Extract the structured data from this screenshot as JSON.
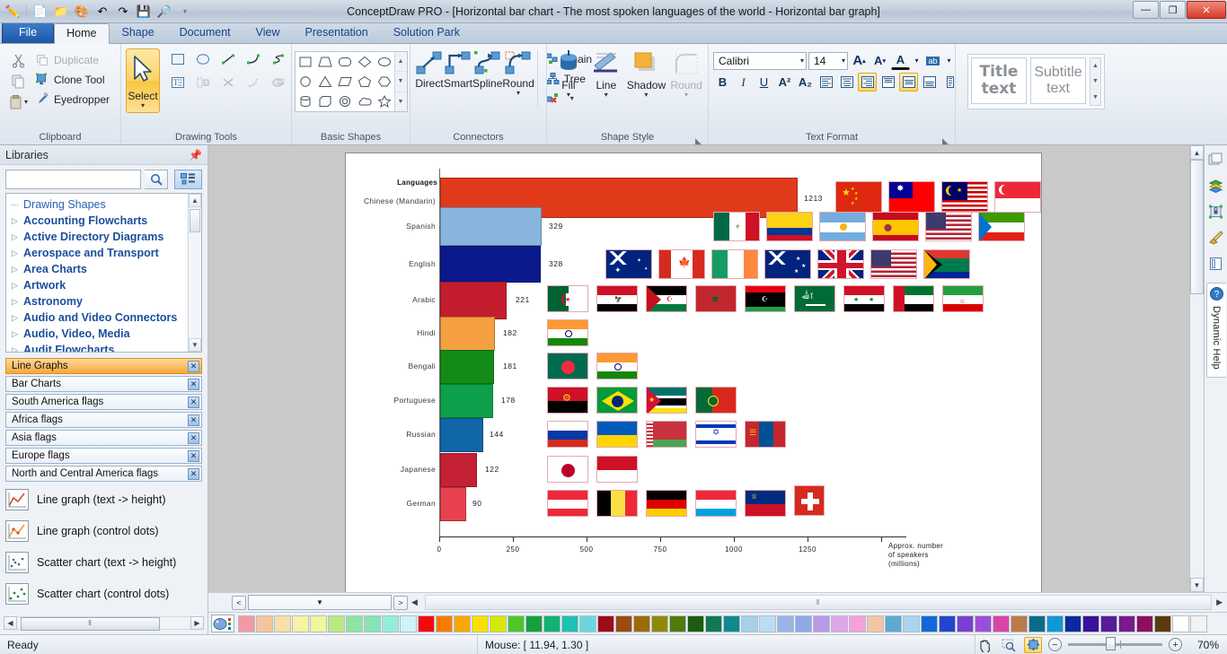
{
  "window": {
    "title": "ConceptDraw PRO - [Horizontal bar chart - The most spoken languages of the world - Horizontal bar graph]",
    "minimize": "—",
    "maximize": "❐",
    "close": "✕"
  },
  "quick_access": [
    {
      "name": "pen-icon",
      "glyph": "✏"
    },
    {
      "name": "new-document-icon",
      "glyph": "📄"
    },
    {
      "name": "open-folder-icon",
      "glyph": "📂"
    },
    {
      "name": "colors-icon",
      "glyph": "🎨"
    },
    {
      "name": "undo-icon",
      "glyph": "↶"
    },
    {
      "name": "redo-icon",
      "glyph": "↷"
    },
    {
      "name": "save-icon",
      "glyph": "💾"
    },
    {
      "name": "print-preview-icon",
      "glyph": "🔍"
    }
  ],
  "tabs": [
    {
      "label": "File",
      "active": false,
      "file": true
    },
    {
      "label": "Home",
      "active": true
    },
    {
      "label": "Shape",
      "active": false
    },
    {
      "label": "Document",
      "active": false
    },
    {
      "label": "View",
      "active": false
    },
    {
      "label": "Presentation",
      "active": false
    },
    {
      "label": "Solution Park",
      "active": false
    }
  ],
  "ribbon": {
    "clipboard": {
      "label": "Clipboard",
      "cut": "Cut",
      "copy": "Copy",
      "paste": "Paste",
      "duplicate": "Duplicate",
      "clone_tool": "Clone Tool",
      "eyedropper": "Eyedropper"
    },
    "drawing_tools": {
      "label": "Drawing Tools",
      "select": "Select"
    },
    "basic_shapes": {
      "label": "Basic Shapes"
    },
    "connectors": {
      "label": "Connectors",
      "direct": "Direct",
      "smart": "Smart",
      "spline": "Spline",
      "round": "Round",
      "chain": "Chain",
      "tree": "Tree"
    },
    "shape_style": {
      "label": "Shape Style",
      "fill": "Fill",
      "line": "Line",
      "shadow": "Shadow",
      "round": "Round"
    },
    "text_format": {
      "label": "Text Format",
      "font_name": "Calibri",
      "font_size": "14",
      "bold": "B",
      "italic": "I",
      "underline": "U",
      "superscript": "A²",
      "subscript": "A₂",
      "grow_font": "A",
      "shrink_font": "A",
      "font_color": "A",
      "highlight": "ab"
    },
    "styles": {
      "title_text": "Title\ntext",
      "title_line1": "Title",
      "title_line2": "text",
      "subtitle_line1": "Subtitle",
      "subtitle_line2": "text"
    }
  },
  "libraries": {
    "header": "Libraries",
    "pin_glyph": "⊥",
    "search": {
      "value": "",
      "placeholder": ""
    },
    "tree": [
      {
        "label": "Drawing Shapes",
        "bold": false
      },
      {
        "label": "Accounting Flowcharts",
        "bold": true
      },
      {
        "label": "Active Directory Diagrams",
        "bold": true
      },
      {
        "label": "Aerospace and Transport",
        "bold": true
      },
      {
        "label": "Area Charts",
        "bold": true
      },
      {
        "label": "Artwork",
        "bold": true
      },
      {
        "label": "Astronomy",
        "bold": true
      },
      {
        "label": "Audio and Video Connectors",
        "bold": true
      },
      {
        "label": "Audio, Video, Media",
        "bold": true
      },
      {
        "label": "Audit Flowcharts",
        "bold": true
      }
    ],
    "open_tabs": [
      {
        "label": "Line Graphs",
        "active": true
      },
      {
        "label": "Bar Charts",
        "active": false
      },
      {
        "label": "South America flags",
        "active": false
      },
      {
        "label": "Africa flags",
        "active": false
      },
      {
        "label": "Asia flags",
        "active": false
      },
      {
        "label": "Europe flags",
        "active": false
      },
      {
        "label": "North and Central America flags",
        "active": false
      }
    ],
    "shapes": [
      {
        "label": "Line graph (text -> height)",
        "icon": "line-graph-icon"
      },
      {
        "label": "Line graph (control dots)",
        "icon": "line-graph-dots-icon"
      },
      {
        "label": "Scatter chart (text -> height)",
        "icon": "scatter-chart-icon"
      },
      {
        "label": "Scatter chart (control dots)",
        "icon": "scatter-chart-dots-icon"
      }
    ],
    "close_glyph": "✖"
  },
  "right_strip": {
    "icons": [
      {
        "name": "layers-icon",
        "glyph": "❐"
      },
      {
        "name": "stack-icon",
        "glyph": "▤"
      },
      {
        "name": "lock-icon",
        "glyph": "🔒"
      },
      {
        "name": "brush-icon",
        "glyph": "🖌"
      },
      {
        "name": "panel-icon",
        "glyph": "▯"
      },
      {
        "name": "help-icon",
        "glyph": "?"
      }
    ],
    "dynamic_help": "Dynamic Help"
  },
  "page_bar": {
    "prev": "<",
    "next": ">",
    "page_selector": "",
    "left_arrow": "◀",
    "scroll_grip": "⦀"
  },
  "statusbar": {
    "ready": "Ready",
    "mouse": "Mouse: [ 11.94, 1.30 ]",
    "zoom_percent": "70%",
    "pan_icon": "✋",
    "zoom_icon": "🔍",
    "fit_icon": "⛶",
    "minus": "−",
    "plus": "+"
  },
  "chart_data": {
    "type": "bar",
    "orientation": "horizontal",
    "title": "Languages",
    "xlabel": "Approx. number of speakers (millions)",
    "xlabel_lines": [
      "Approx. number",
      "of speakers",
      "(millions)"
    ],
    "ylabel": "",
    "xlim": [
      0,
      1350
    ],
    "xticks": [
      0,
      250,
      500,
      750,
      1000,
      1250
    ],
    "xticklabels": [
      "0",
      "250",
      "500",
      "750",
      "1000",
      "1250"
    ],
    "grid": false,
    "legend": "none",
    "categories": [
      "Chinese (Mandarin)",
      "Spanish",
      "English",
      "Arabic",
      "Hindi",
      "Bengali",
      "Portuguese",
      "Russian",
      "Japanese",
      "German"
    ],
    "values": [
      1213,
      329,
      328,
      221,
      182,
      181,
      178,
      144,
      122,
      90
    ],
    "colors": [
      "#e03a1a",
      "#87b5de",
      "#0a1a8c",
      "#c41e2e",
      "#f5a040",
      "#128c16",
      "#0ea04a",
      "#1166a8",
      "#c52134",
      "#e8414f"
    ],
    "bar_flags": [
      [
        "China",
        "Taiwan",
        "Malaysia",
        "Singapore"
      ],
      [
        "Mexico",
        "Colombia",
        "Argentina",
        "Spain",
        "United States",
        "Equatorial Guinea"
      ],
      [
        "Australia",
        "Canada",
        "Ireland",
        "New Zealand",
        "United Kingdom",
        "United States",
        "South Africa"
      ],
      [
        "Algeria",
        "Egypt",
        "Western Sahara",
        "Morocco",
        "Libya",
        "Saudi Arabia",
        "Syria",
        "United Arab Emirates",
        "Iran"
      ],
      [
        "India"
      ],
      [
        "Bangladesh",
        "India"
      ],
      [
        "Angola",
        "Brazil",
        "Mozambique",
        "Portugal"
      ],
      [
        "Russia",
        "Ukraine",
        "Belarus",
        "Israel",
        "Mongolia"
      ],
      [
        "Japan",
        "Indonesia"
      ],
      [
        "Austria",
        "Belgium",
        "Germany",
        "Luxembourg",
        "Liechtenstein",
        "Switzerland"
      ]
    ]
  },
  "palette": {
    "swatches": [
      "#f29aa4",
      "#f7c49a",
      "#fadfa8",
      "#fbf0a6",
      "#f0f79c",
      "#b9ea7e",
      "#8fe3a0",
      "#86e3b6",
      "#92eedc",
      "#cdf4f7",
      "#f20a0a",
      "#f77c00",
      "#fba600",
      "#fbe000",
      "#d7e800",
      "#4fc52a",
      "#16a03c",
      "#13b173",
      "#1bc2b0",
      "#6ad7e0",
      "#9d0a18",
      "#9c4a10",
      "#9c6a08",
      "#8e8a08",
      "#4f7a0c",
      "#1c5c12",
      "#0f7a52",
      "#0f8a8c",
      "#a8cfe8",
      "#bbdcf5",
      "#98b4e8",
      "#8fa8e8",
      "#b79ae8",
      "#dfa5e8",
      "#f6a0da",
      "#f2c6a2",
      "#5fa8d0",
      "#a9d4ef",
      "#1268d8",
      "#2046d0",
      "#7a3fd0",
      "#9b4fd8",
      "#d845a8",
      "#bb7a4a",
      "#0b6a8a",
      "#0f97d8",
      "#0b2a9c",
      "#3a109c",
      "#5a1a9c",
      "#7a1a8c",
      "#8c1060",
      "#5c3a10",
      "#ffffff",
      "#f2f2f2"
    ]
  }
}
